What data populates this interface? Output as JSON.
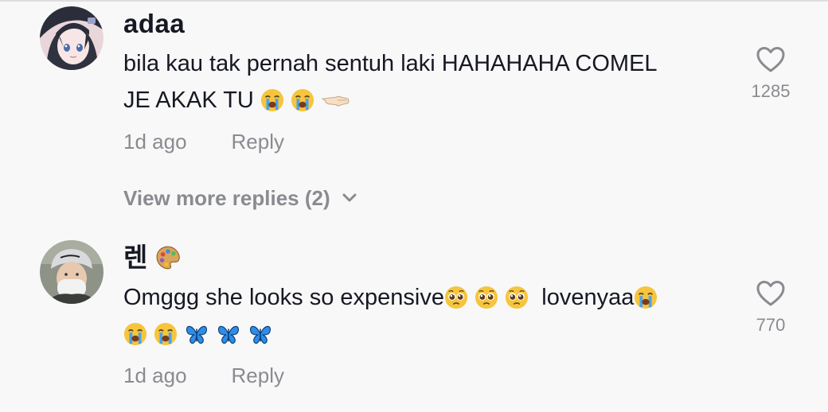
{
  "comments": [
    {
      "username": "adaa",
      "text_line1": "bila kau tak pernah sentuh laki HAHAHAHA COMEL",
      "text_line2": "JE AKAK TU",
      "time": "1d ago",
      "reply_label": "Reply",
      "likes": "1285",
      "view_more": "View more replies (2)",
      "emojis_line2": [
        "loudly-crying-face",
        "loudly-crying-face",
        "left-pointing-hand"
      ]
    },
    {
      "username": "렌",
      "username_emoji": "artist-palette",
      "text_part1": "Omggg she looks so expensive",
      "text_part2": "lovenyaa",
      "time": "1d ago",
      "reply_label": "Reply",
      "likes": "770",
      "emojis_line1": [
        "pleading-face",
        "pleading-face",
        "pleading-face",
        "loudly-crying-face"
      ],
      "emojis_line2": [
        "loudly-crying-face",
        "loudly-crying-face",
        "blue-butterfly",
        "blue-butterfly",
        "blue-butterfly"
      ]
    }
  ],
  "colors": {
    "text_primary": "#161823",
    "text_secondary": "#8a8b91",
    "background": "#f8f8f8"
  }
}
